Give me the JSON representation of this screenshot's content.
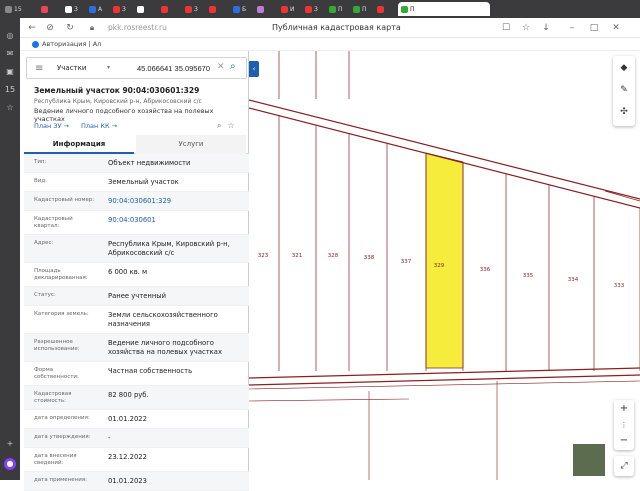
{
  "browser": {
    "tabs": [
      {
        "label": "15",
        "color": "#888"
      },
      {
        "label": "",
        "color": "#e45"
      },
      {
        "label": "З",
        "color": "#fff"
      },
      {
        "label": "А",
        "color": "#2a6ee8"
      },
      {
        "label": "З",
        "color": "#e33"
      },
      {
        "label": "",
        "color": "#fff"
      },
      {
        "label": "",
        "color": "#e33"
      },
      {
        "label": "З",
        "color": "#e33"
      },
      {
        "label": "",
        "color": "#e33"
      },
      {
        "label": "Б",
        "color": "#2a6ee8"
      },
      {
        "label": "",
        "color": "#c07bd8"
      },
      {
        "label": "И",
        "color": "#e33"
      },
      {
        "label": "З",
        "color": "#e33"
      },
      {
        "label": "П",
        "color": "#3a3"
      },
      {
        "label": "П",
        "color": "#3a3"
      },
      {
        "label": "",
        "color": "#e33"
      },
      {
        "label": "П",
        "color": "#3a3"
      }
    ],
    "url": "pkk.rosreestr.ru",
    "page_title": "Публичная кадастровая карта",
    "bookmark": "Авторизация | Ал"
  },
  "search": {
    "category": "Участки",
    "coords": "45.066641 35.095670"
  },
  "object": {
    "title": "Земельный участок 90:04:030601:329",
    "address": "Республика Крым, Кировский р-н, Абрикосовский с/с",
    "use": "Ведение личного подсобного хозяйства на полевых участках",
    "plan_zu": "План ЗУ →",
    "plan_kk": "План КК →"
  },
  "tabs": {
    "info": "Информация",
    "services": "Услуги"
  },
  "rows": [
    {
      "k": "Тип:",
      "v": "Объект недвижимости",
      "link": false
    },
    {
      "k": "Вид:",
      "v": "Земельный участок",
      "link": false
    },
    {
      "k": "Кадастровый номер:",
      "v": "90:04:030601:329",
      "link": true
    },
    {
      "k": "Кадастровый квартал:",
      "v": "90:04:030601",
      "link": true
    },
    {
      "k": "Адрес:",
      "v": "Республика Крым, Кировский р-н, Абрикосовский с/с",
      "link": false
    },
    {
      "k": "Площадь декларированная:",
      "v": "6 000 кв. м",
      "link": false
    },
    {
      "k": "Статус:",
      "v": "Ранее учтенный",
      "link": false
    },
    {
      "k": "Категория земель:",
      "v": "Земли сельскохозяйственного назначения",
      "link": false
    },
    {
      "k": "Разрешенное использование:",
      "v": "Ведение личного подсобного хозяйства на полевых участках",
      "link": false
    },
    {
      "k": "Форма собственности:",
      "v": "Частная собственность",
      "link": false
    },
    {
      "k": "Кадастровая стоимость:",
      "v": "82 800 руб.",
      "link": false
    },
    {
      "k": "дата определения:",
      "v": "01.01.2022",
      "link": false
    },
    {
      "k": "дата утверждения:",
      "v": "-",
      "link": false
    },
    {
      "k": "дата внесения сведений:",
      "v": "23.12.2022",
      "link": false
    },
    {
      "k": "дата применения:",
      "v": "01.01.2023",
      "link": false
    }
  ],
  "map": {
    "parcels": [
      "323",
      "321",
      "328",
      "338",
      "337",
      "329",
      "336",
      "335",
      "334",
      "333"
    ],
    "selected_color": "#f5ec3b",
    "boundary_color": "#8a1f1f"
  },
  "colors": {
    "accent": "#1f5fb3"
  }
}
